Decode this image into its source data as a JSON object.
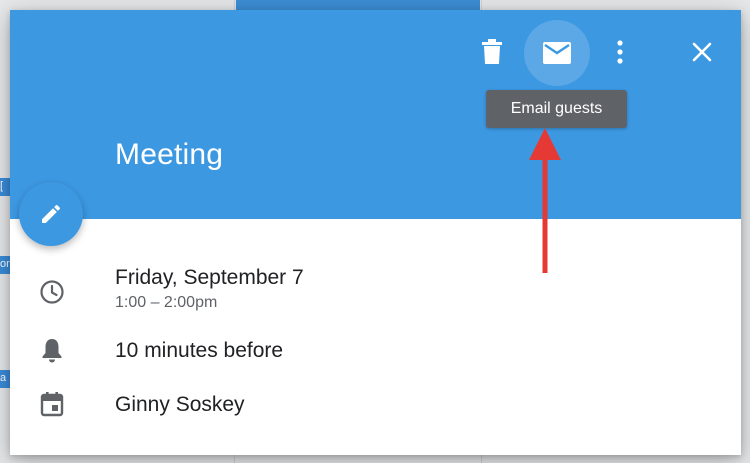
{
  "event": {
    "title": "Meeting",
    "date": "Friday, September 7",
    "time": "1:00 – 2:00pm",
    "reminder": "10 minutes before",
    "calendar_owner": "Ginny Soskey"
  },
  "toolbar": {
    "tooltip": "Email guests",
    "icons": [
      "delete-icon",
      "email-icon",
      "more-vert-icon",
      "close-icon"
    ]
  },
  "fab": {
    "icon": "edit-icon"
  },
  "rows": {
    "icons": [
      "clock-icon",
      "bell-icon",
      "calendar-icon"
    ]
  },
  "background": {
    "left_chips": [
      "[",
      "on",
      "a"
    ]
  },
  "colors": {
    "header": "#3d98e2",
    "tooltip_bg": "#5f6368",
    "annotation": "#e53935"
  }
}
